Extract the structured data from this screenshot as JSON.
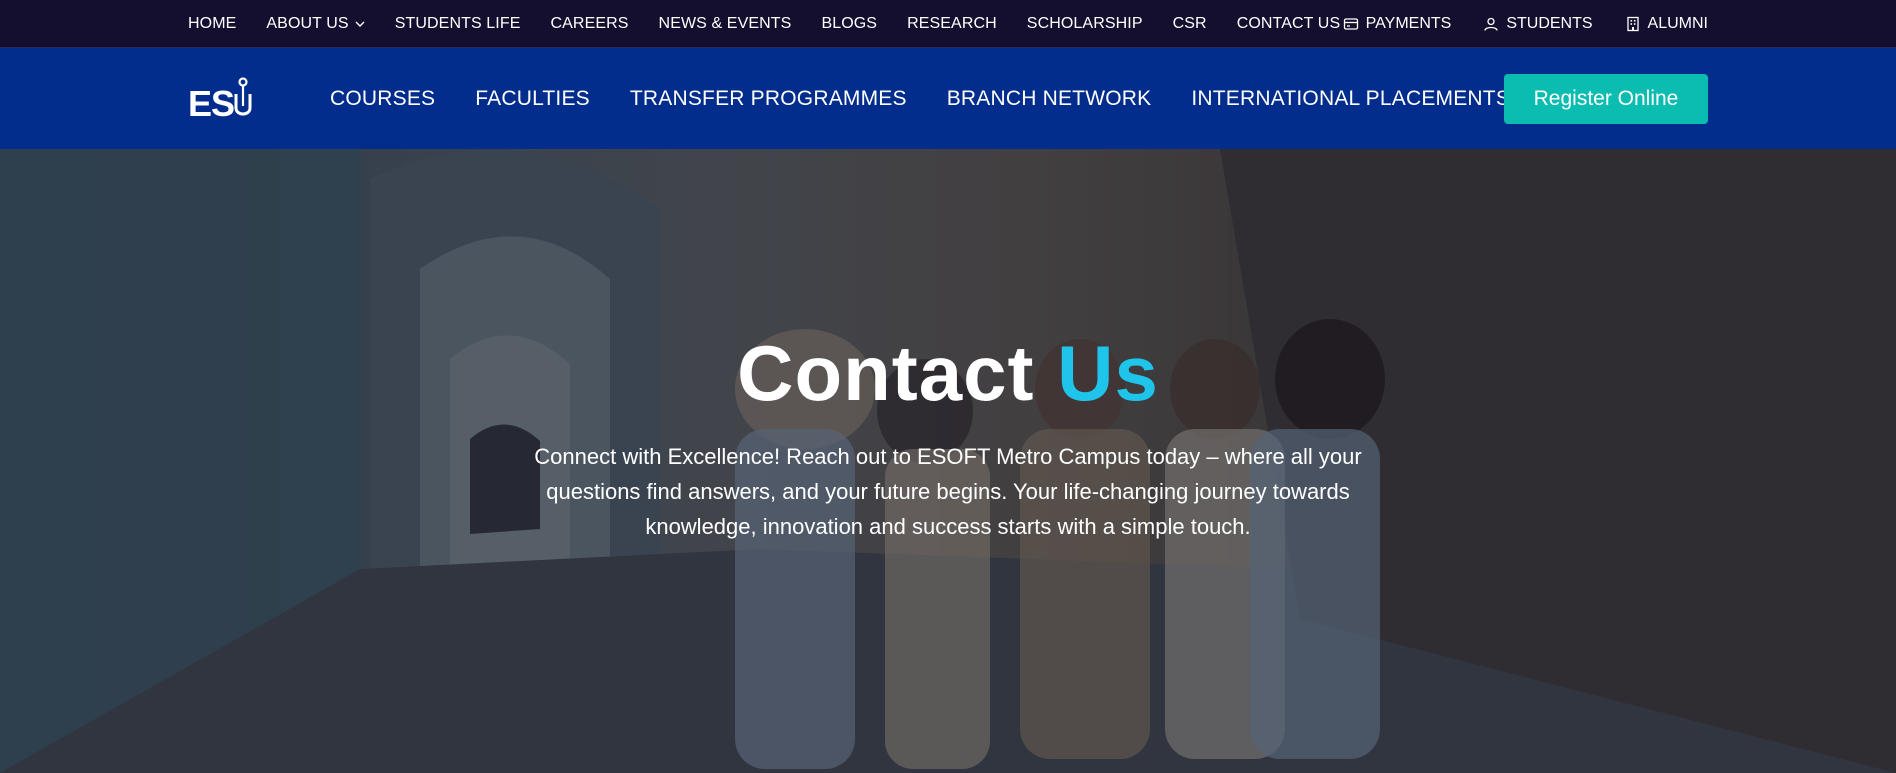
{
  "topbar": {
    "links": [
      "HOME",
      "ABOUT US",
      "STUDENTS LIFE",
      "CAREERS",
      "NEWS & EVENTS",
      "BLOGS",
      "RESEARCH",
      "SCHOLARSHIP",
      "CSR",
      "CONTACT US"
    ],
    "payments": "PAYMENTS",
    "students": "STUDENTS",
    "alumni": "ALUMNI"
  },
  "mainnav": {
    "logo": "ESU",
    "links": [
      "COURSES",
      "FACULTIES",
      "TRANSFER PROGRAMMES",
      "BRANCH NETWORK",
      "INTERNATIONAL PLACEMENTS"
    ],
    "register": "Register Online"
  },
  "hero": {
    "title_part1": "Contact",
    "title_part2": "Us",
    "text": "Connect with Excellence! Reach out to ESOFT Metro Campus today – where all your questions find answers, and your future begins. Your life-changing journey towards knowledge, innovation and success starts with a simple touch."
  },
  "colors": {
    "topbar_bg": "#140f2e",
    "nav_bg": "#022d8c",
    "register_bg": "#0bbcb0",
    "accent": "#1ec4ea"
  }
}
